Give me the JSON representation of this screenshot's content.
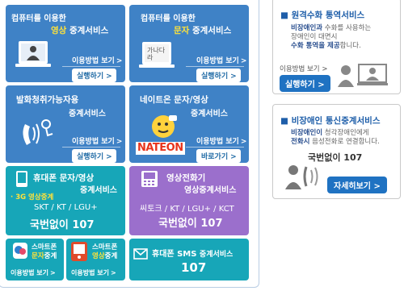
{
  "tiles": {
    "computer_video": {
      "line1": "컴퓨터를 이용한",
      "line2_pre": "",
      "line2_hl": "영상",
      "line2_post": " 중계서비스",
      "guide": "이용방법 보기",
      "run": "실행하기"
    },
    "computer_text": {
      "line1": "컴퓨터를 이용한",
      "line2_hl": "문자",
      "line2_post": " 중계서비스",
      "guide": "이용방법 보기",
      "run": "실행하기",
      "icon_text": "가나다라"
    },
    "speech_impaired": {
      "line1": "발화청취가능자용",
      "line2": "중계서비스",
      "guide": "이용방법 보기",
      "run": "실행하기"
    },
    "nateon": {
      "line1": "네이트온 문자/영상",
      "line2": "중계서비스",
      "guide": "이용방법 보기",
      "run": "바로가기",
      "logo": "NATEON"
    },
    "mobile_text_video": {
      "line1": "휴대폰 문자/영상",
      "line2": "중계서비스",
      "tag": "· 3G 영상중계",
      "carriers": "SKT / KT / LGU+",
      "number": "국번없이 107"
    },
    "video_phone": {
      "line1": "영상전화기",
      "line2": "영상중계서비스",
      "carriers": "씨토크 / KT / LGU+ / KCT",
      "number": "국번없이 107"
    },
    "smartphone_text": {
      "line1": "스마트폰",
      "line2_hl": "문자",
      "line2_post": "중계",
      "guide": "이용방법 보기"
    },
    "smartphone_video": {
      "line1": "스마트폰",
      "line2_hl": "영상",
      "line2_post": "중계",
      "guide": "이용방법 보기"
    },
    "mobile_sms": {
      "title": "휴대폰 SMS",
      "subtitle": "중계서비스",
      "number": "107"
    }
  },
  "right": {
    "remote_sign": {
      "title": "■ 원격수화 통역서비스",
      "desc_b": "비장애인과",
      "desc1": " 수화를 사용하는",
      "desc2": "장애인이 대면시",
      "desc3_b": "수화 통역을 제공",
      "desc3": "합니다.",
      "guide": "이용방법 보기",
      "run": "실행하기"
    },
    "nondisabled": {
      "title": "■ 비장애인 통신중계서비스",
      "desc1_b": "비장애인이",
      "desc1": " 청각장애인에게",
      "desc2_b": "전화시",
      "desc2": " 음성전화로 연결합니다.",
      "number": "국번없이 107",
      "more": "자세히보기"
    }
  },
  "colors": {
    "blue": "#3f82c6",
    "teal": "#17a6b8",
    "purple": "#9b6fcc",
    "highlight": "#ffe23a",
    "brand": "#1f72c2"
  }
}
